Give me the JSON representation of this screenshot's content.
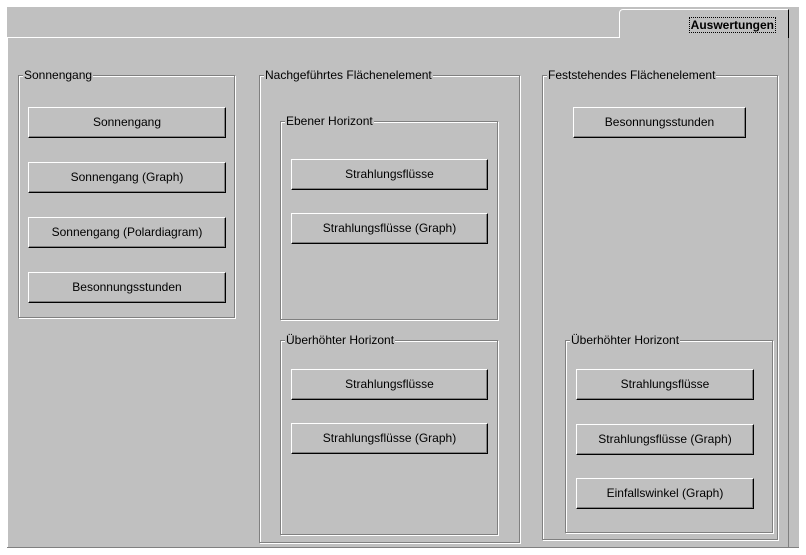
{
  "tab": {
    "label": "Auswertungen"
  },
  "sonnengang": {
    "title": "Sonnengang",
    "buttons": [
      "Sonnengang",
      "Sonnengang (Graph)",
      "Sonnengang (Polardiagram)",
      "Besonnungsstunden"
    ]
  },
  "nachgefuehrt": {
    "title": "Nachgeführtes Flächenelement",
    "ebener": {
      "title": "Ebener Horizont",
      "buttons": [
        "Strahlungsflüsse",
        "Strahlungsflüsse (Graph)"
      ]
    },
    "ueberhoeht": {
      "title": "Überhöhter Horizont",
      "buttons": [
        "Strahlungsflüsse",
        "Strahlungsflüsse (Graph)"
      ]
    }
  },
  "feststehend": {
    "title": "Feststehendes Flächenelement",
    "buttons": [
      "Besonnungsstunden"
    ],
    "ueberhoeht": {
      "title": "Überhöhter Horizont",
      "buttons": [
        "Strahlungsflüsse",
        "Strahlungsflüsse (Graph)",
        "Einfallswinkel (Graph)"
      ]
    }
  }
}
